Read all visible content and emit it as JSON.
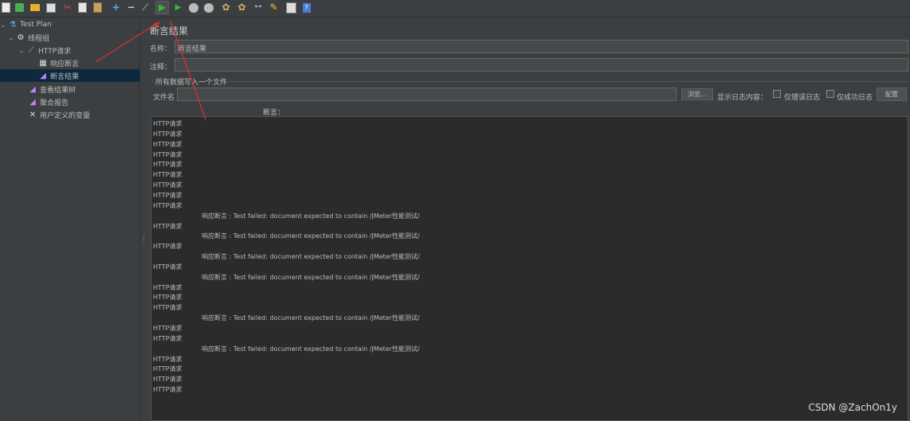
{
  "toolbar": {
    "icons": [
      "new-icon",
      "templates-icon",
      "open-icon",
      "save-icon",
      "cut-icon",
      "copy-icon",
      "paste-icon",
      "expand-icon",
      "collapse-icon",
      "toggle-icon",
      "start-icon",
      "start-no-pause-icon",
      "stop-icon",
      "shutdown-icon",
      "remote-start-icon",
      "remote-stop-icon",
      "clear-icon",
      "clear-all-icon",
      "search-icon",
      "reset-search-icon",
      "function-helper-icon",
      "help-icon"
    ]
  },
  "tree": {
    "items": [
      {
        "label": "Test Plan",
        "icon": "flask-icon"
      },
      {
        "label": "线程组",
        "icon": "gear-icon"
      },
      {
        "label": "HTTP请求",
        "icon": "pipette-icon"
      },
      {
        "label": "响应断言",
        "icon": "assertion-icon"
      },
      {
        "label": "断言结果",
        "icon": "chart-icon"
      },
      {
        "label": "查看结果树",
        "icon": "chart-icon"
      },
      {
        "label": "聚合报告",
        "icon": "chart-icon"
      },
      {
        "label": "用户定义的变量",
        "icon": "tools-icon"
      }
    ]
  },
  "panel": {
    "title": "断言结果",
    "name_label": "名称：",
    "name_value": "断言结果",
    "comment_label": "注释：",
    "comment_value": "",
    "group_title": "所有数据写入一个文件",
    "filename_label": "文件名",
    "filename_value": "",
    "browse_button": "浏览...",
    "log_label": "显示日志内容：",
    "errors_only": "仅错误日志",
    "success_only": "仅成功日志",
    "config_button": "配置",
    "assertion_header": "断言："
  },
  "results": [
    {
      "text": "HTTP请求",
      "type": "sample"
    },
    {
      "text": "HTTP请求",
      "type": "sample"
    },
    {
      "text": "HTTP请求",
      "type": "sample"
    },
    {
      "text": "HTTP请求",
      "type": "sample"
    },
    {
      "text": "HTTP请求",
      "type": "sample"
    },
    {
      "text": "HTTP请求",
      "type": "sample"
    },
    {
      "text": "HTTP请求",
      "type": "sample"
    },
    {
      "text": "HTTP请求",
      "type": "sample"
    },
    {
      "text": "HTTP请求",
      "type": "sample"
    },
    {
      "text": "响应断言 : Test failed: document expected to contain /JMeter性能测试/",
      "type": "msg"
    },
    {
      "text": "HTTP请求",
      "type": "sample"
    },
    {
      "text": "响应断言 : Test failed: document expected to contain /JMeter性能测试/",
      "type": "msg"
    },
    {
      "text": "HTTP请求",
      "type": "sample"
    },
    {
      "text": "响应断言 : Test failed: document expected to contain /JMeter性能测试/",
      "type": "msg"
    },
    {
      "text": "HTTP请求",
      "type": "sample"
    },
    {
      "text": "响应断言 : Test failed: document expected to contain /JMeter性能测试/",
      "type": "msg"
    },
    {
      "text": "HTTP请求",
      "type": "sample"
    },
    {
      "text": "HTTP请求",
      "type": "sample"
    },
    {
      "text": "HTTP请求",
      "type": "sample"
    },
    {
      "text": "响应断言 : Test failed: document expected to contain /JMeter性能测试/",
      "type": "msg"
    },
    {
      "text": "HTTP请求",
      "type": "sample"
    },
    {
      "text": "HTTP请求",
      "type": "sample"
    },
    {
      "text": "响应断言 : Test failed: document expected to contain /JMeter性能测试/",
      "type": "msg"
    },
    {
      "text": "HTTP请求",
      "type": "sample"
    },
    {
      "text": "HTTP请求",
      "type": "sample"
    },
    {
      "text": "HTTP请求",
      "type": "sample"
    },
    {
      "text": "HTTP请求",
      "type": "sample"
    }
  ],
  "watermark": "CSDN @ZachOn1y",
  "colors": {
    "background": "#3c3f41",
    "selection": "#0d293e",
    "annotation_arrow": "#e03030",
    "start_icon": "#2fbf2f"
  }
}
